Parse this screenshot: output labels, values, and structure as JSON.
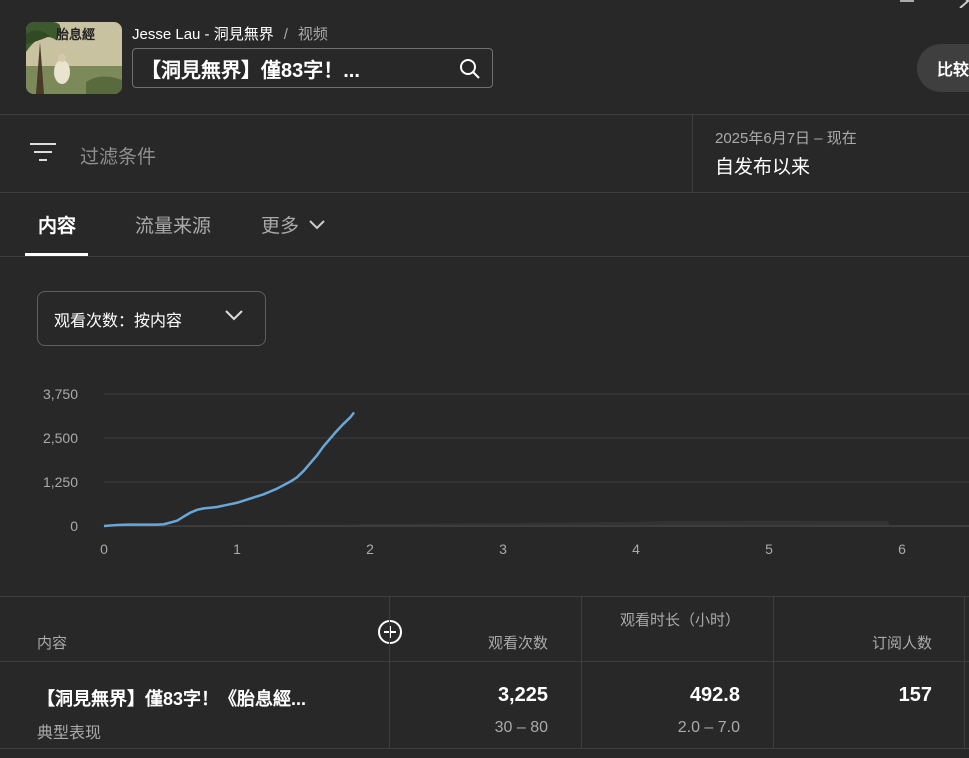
{
  "header": {
    "thumbnail_title": "胎息經",
    "channel": "Jesse Lau - 洞見無界",
    "separator": "/",
    "section": "视频",
    "video_title": "【洞見無界】僅83字！...",
    "compare_label": "比较"
  },
  "filter": {
    "placeholder": "过滤条件",
    "date_range": "2025年6月7日 – 现在",
    "date_label": "自发布以来"
  },
  "tabs": [
    {
      "label": "内容",
      "active": true
    },
    {
      "label": "流量来源",
      "active": false
    },
    {
      "label": "更多",
      "active": false
    }
  ],
  "metric_dropdown": {
    "label": "观看次数：按内容"
  },
  "chart_data": {
    "type": "line",
    "yticks": [
      "3,750",
      "2,500",
      "1,250",
      "0"
    ],
    "ytick_values": [
      3750,
      2500,
      1250,
      0
    ],
    "xticks": [
      "0",
      "1",
      "2",
      "3",
      "4",
      "5",
      "6"
    ],
    "ylim": [
      0,
      3750
    ],
    "xlim": [
      0,
      6.5
    ],
    "grid": true,
    "series": [
      {
        "color": "#6aa7d9",
        "x": [
          0,
          0.1,
          0.2,
          0.3,
          0.4,
          0.45,
          0.5,
          0.55,
          0.6,
          0.65,
          0.7,
          0.75,
          0.8,
          0.85,
          0.9,
          0.95,
          1.0,
          1.05,
          1.1,
          1.15,
          1.2,
          1.25,
          1.3,
          1.35,
          1.4,
          1.45,
          1.5,
          1.55,
          1.6,
          1.65,
          1.7,
          1.75,
          1.8,
          1.85,
          1.88
        ],
        "y": [
          0,
          30,
          40,
          40,
          40,
          50,
          100,
          150,
          270,
          380,
          460,
          500,
          520,
          540,
          580,
          620,
          660,
          720,
          780,
          840,
          900,
          980,
          1060,
          1160,
          1260,
          1380,
          1560,
          1780,
          2000,
          2260,
          2480,
          2700,
          2900,
          3080,
          3225
        ]
      },
      {
        "color": "#3a3a3a",
        "x": [
          0,
          1,
          2,
          3,
          4,
          4.2,
          5,
          5.9
        ],
        "y": [
          0,
          30,
          50,
          80,
          120,
          140,
          150,
          140
        ]
      }
    ]
  },
  "table": {
    "columns": [
      "内容",
      "观看次数",
      "观看时长（小时）",
      "订阅人数"
    ],
    "rows": [
      {
        "title": "【洞見無界】僅83字！《胎息經...",
        "subtitle": "典型表现",
        "views": "3,225",
        "views_range": "30 – 80",
        "watch_time": "492.8",
        "watch_time_range": "2.0 – 7.0",
        "subscribers": "157"
      }
    ]
  }
}
